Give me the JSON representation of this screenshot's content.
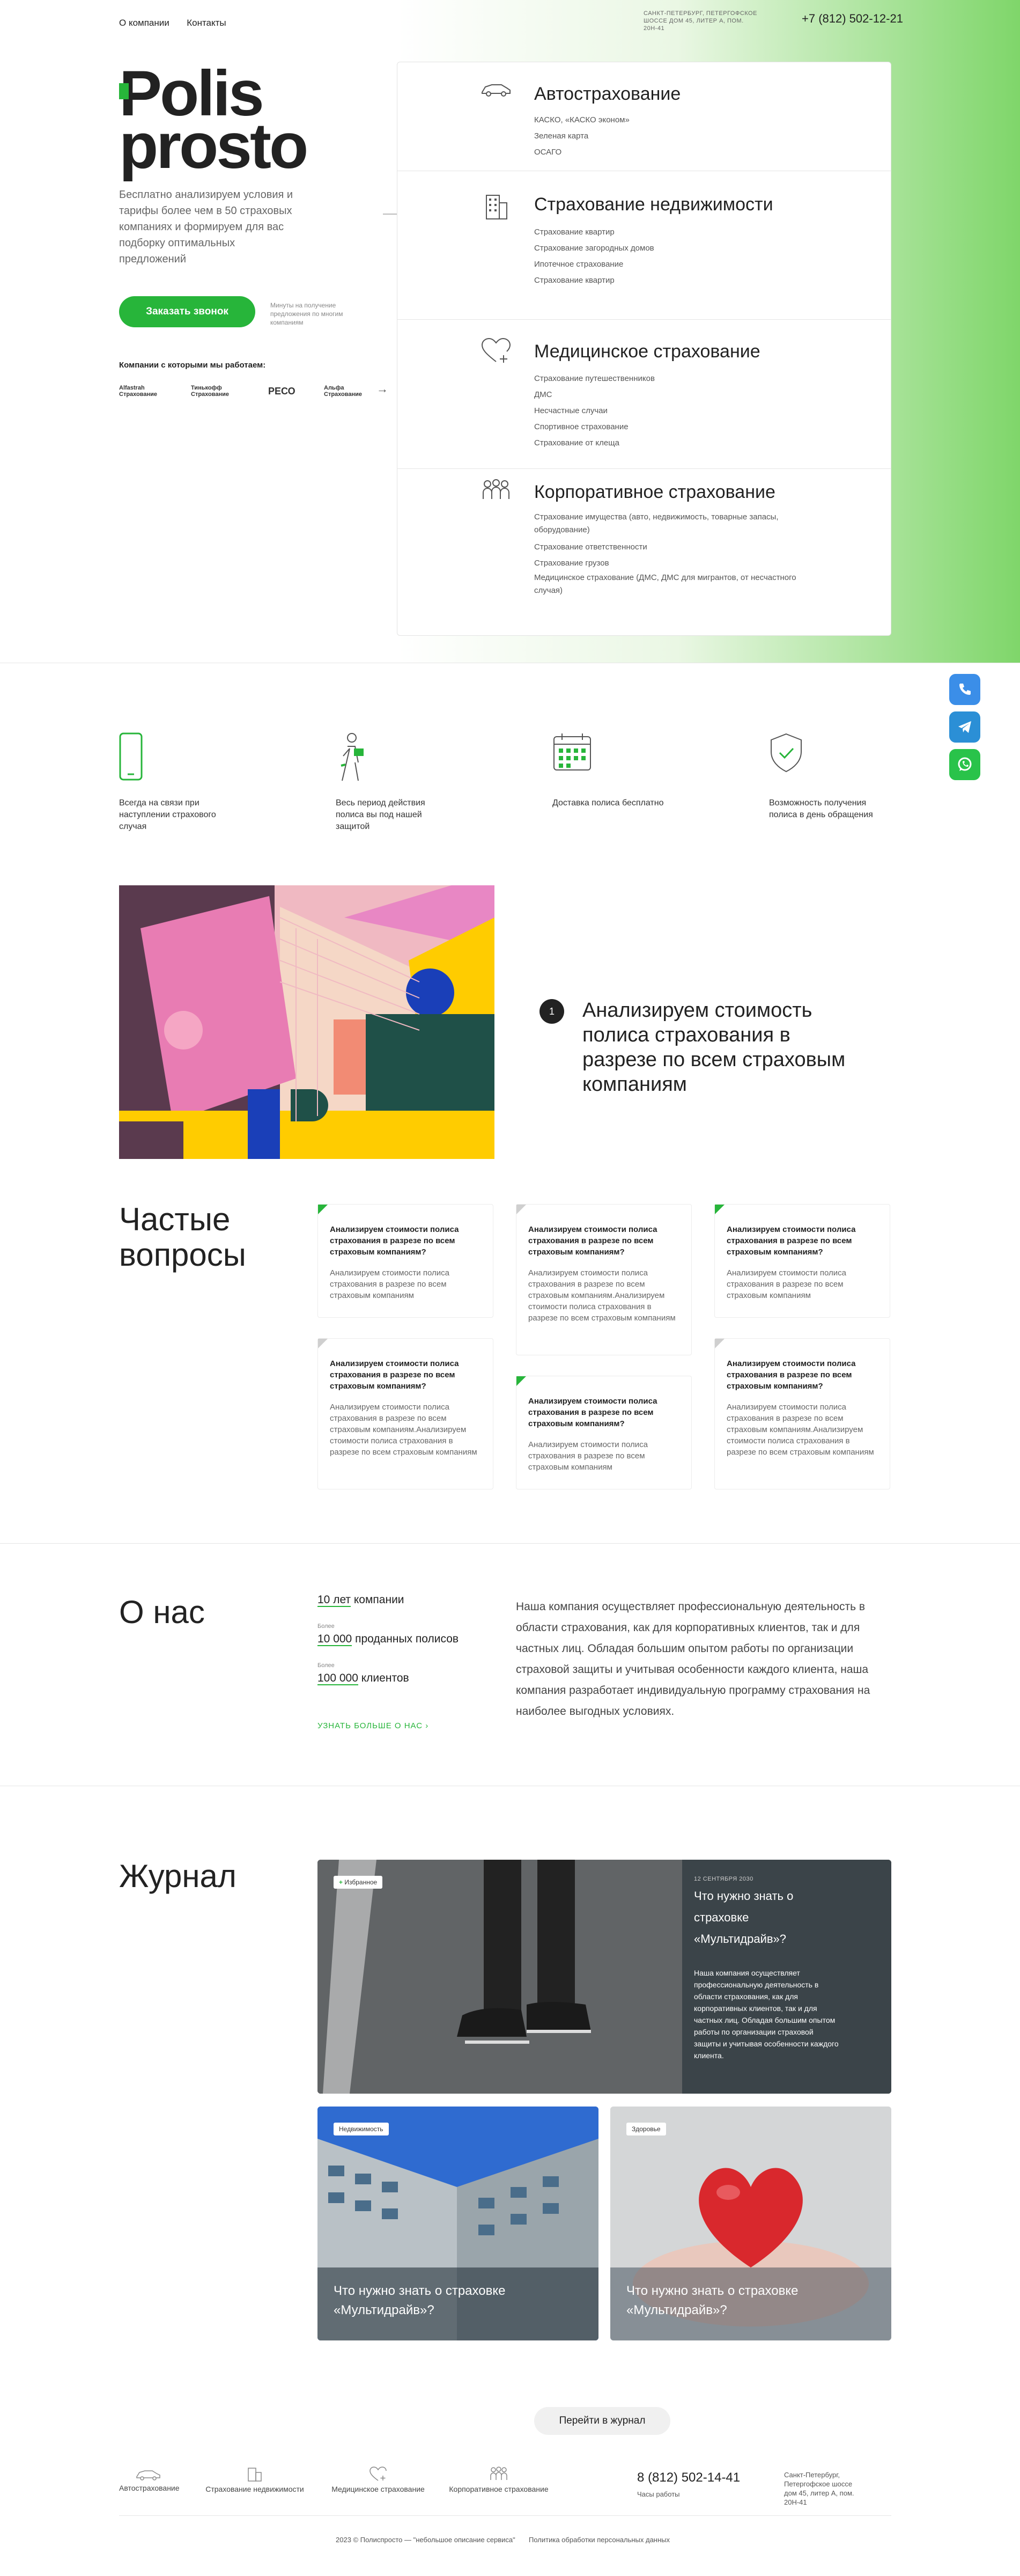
{
  "header": {
    "nav": [
      "О компании",
      "Контакты"
    ],
    "address": "САНКТ-ПЕТЕРБУРГ, ПЕТЕРГОФСКОЕ ШОССЕ ДОМ 45, ЛИТЕР А, ПОМ. 20Н-41",
    "phone": "+7 (812) 502-12-21"
  },
  "hero": {
    "logo_line1": "Polis",
    "logo_line2": "prosto",
    "lead": "Бесплатно анализируем условия и тарифы более чем в 50 страховых компаниях и формируем для вас подборку оптимальных предложений",
    "cta": "Заказать звонок",
    "cta_note": "Минуты на получение предложения по многим компаниям",
    "companies_title": "Компании с которыми мы работаем:",
    "companies": [
      "Alfastrah Страхование",
      "Тинькофф Страхование",
      "РЕСО",
      "Альфа Страхование"
    ]
  },
  "categories": [
    {
      "title": "Автострахование",
      "icon": "car-icon",
      "items": [
        "КАСКО, «КАСКО эконом»",
        "Зеленая карта",
        "ОСАГО"
      ]
    },
    {
      "title": "Страхование недвижимости",
      "icon": "building-icon",
      "items": [
        "Страхование квартир",
        "Страхование загородных домов",
        "Ипотечное страхование",
        "Страхование квартир"
      ]
    },
    {
      "title": "Медицинское страхование",
      "icon": "heart-plus-icon",
      "items": [
        "Страхование путешественников",
        "ДМС",
        "Несчастные случаи",
        "Спортивное страхование",
        "Страхование от клеща"
      ]
    },
    {
      "title": "Корпоративное страхование",
      "icon": "people-icon",
      "items": [
        "Страхование имущества (авто, недвижимость, товарные запасы, оборудование)",
        "Страхование ответственности",
        "Страхование грузов",
        "Медицинское страхование (ДМС, ДМС для мигрантов, от несчастного случая)"
      ]
    }
  ],
  "side": {
    "phone_icon": "phone-icon",
    "telegram_icon": "telegram-icon",
    "whatsapp_icon": "whatsapp-icon"
  },
  "features": [
    {
      "icon": "smartphone-icon",
      "text": "Всегда на связи при наступлении страхового случая"
    },
    {
      "icon": "person-walking-icon",
      "text": "Весь период действия полиса вы под нашей защитой"
    },
    {
      "icon": "calendar-icon",
      "text": "Доставка полиса бесплатно"
    },
    {
      "icon": "shield-check-icon",
      "text": "Возможность получения полиса в день обращения"
    }
  ],
  "step": {
    "num": "1",
    "text": "Анализируем стоимость полиса страхования в разрезе по всем страховым компаниям"
  },
  "faq": {
    "title_line1": "Частые",
    "title_line2": "вопросы",
    "items": [
      {
        "q": "Анализируем стоимости полиса страхования в разрезе по всем страховым компаниям?",
        "a": "Анализируем стоимости полиса страхования в разрезе по всем страховым компаниям"
      },
      {
        "q": "Анализируем стоимости полиса страхования в разрезе по всем страховым компаниям?",
        "a": "Анализируем стоимости полиса страхования в разрезе по всем страховым компаниям.Анализируем стоимости полиса страхования в разрезе по всем страховым компаниям"
      },
      {
        "q": "Анализируем стоимости полиса страхования в разрезе по всем страховым компаниям?",
        "a": "Анализируем стоимости полиса страхования в разрезе по всем страховым компаниям"
      },
      {
        "q": "Анализируем стоимости полиса страхования в разрезе по всем страховым компаниям?",
        "a": "Анализируем стоимости полиса страхования в разрезе по всем страховым компаниям.Анализируем стоимости полиса страхования в разрезе по всем страховым компаниям"
      },
      {
        "q": "Анализируем стоимости полиса страхования в разрезе по всем страховым компаниям?",
        "a": "Анализируем стоимости полиса страхования в разрезе по всем страховым компаниям"
      },
      {
        "q": "Анализируем стоимости полиса страхования в разрезе по всем страховым компаниям?",
        "a": "Анализируем стоимости полиса страхования в разрезе по всем страховым компаниям.Анализируем стоимости полиса страхования в разрезе по всем страховым компаниям"
      }
    ]
  },
  "about": {
    "title": "О нас",
    "stat1_num": "10 лет",
    "stat1_txt": " компании",
    "stat2_pre": "Более",
    "stat2_num": "10 000",
    "stat2_txt": " проданных полисов",
    "stat3_pre": "Более",
    "stat3_num": "100 000",
    "stat3_txt": " клиентов",
    "link": "УЗНАТЬ БОЛЬШЕ О НАС",
    "text": "Наша компания осуществляет профессиональную деятельность в области страхования, как для корпоративных клиентов, так и для частных лиц. Обладая большим опытом работы по организации страховой защиты и учитывая особенности каждого клиента, наша компания разработает индивидуальную программу страхования на наиболее выгодных условиях."
  },
  "journal": {
    "title": "Журнал",
    "featured": {
      "tag": "Избранное",
      "date": "12 СЕНТЯБРЯ 2030",
      "title": "Что нужно знать о страховке «Мультидрайв»?",
      "text": "Наша компания осуществляет профессиональную деятельность в области страхования, как для корпоративных клиентов, так и для частных лиц. Обладая большим опытом работы по организации страховой защиты и учитывая особенности каждого клиента."
    },
    "cards": [
      {
        "tag": "Недвижимость",
        "title": "Что нужно знать о страховке «Мультидрайв»?"
      },
      {
        "tag": "Здоровье",
        "title": "Что нужно знать о страховке «Мультидрайв»?"
      }
    ],
    "more": "Перейти в журнал"
  },
  "footer": {
    "items": [
      "Автострахование",
      "Страхование недвижимости",
      "Медицинское страхование",
      "Корпоративное страхование"
    ],
    "phone": "8 (812) 502-14-41",
    "hours": "Часы работы",
    "address": "Санкт-Петербург, Петергофское шоссе дом 45, литер А, пом. 20Н-41",
    "copyright": "2023 © Полиспросто — \"небольшое описание сервиса\"",
    "privacy": "Политика обработки персональных данных"
  },
  "colors": {
    "accent": "#27b53a",
    "telegram": "#2b8fd6",
    "phone_btn": "#3b8ee8"
  }
}
